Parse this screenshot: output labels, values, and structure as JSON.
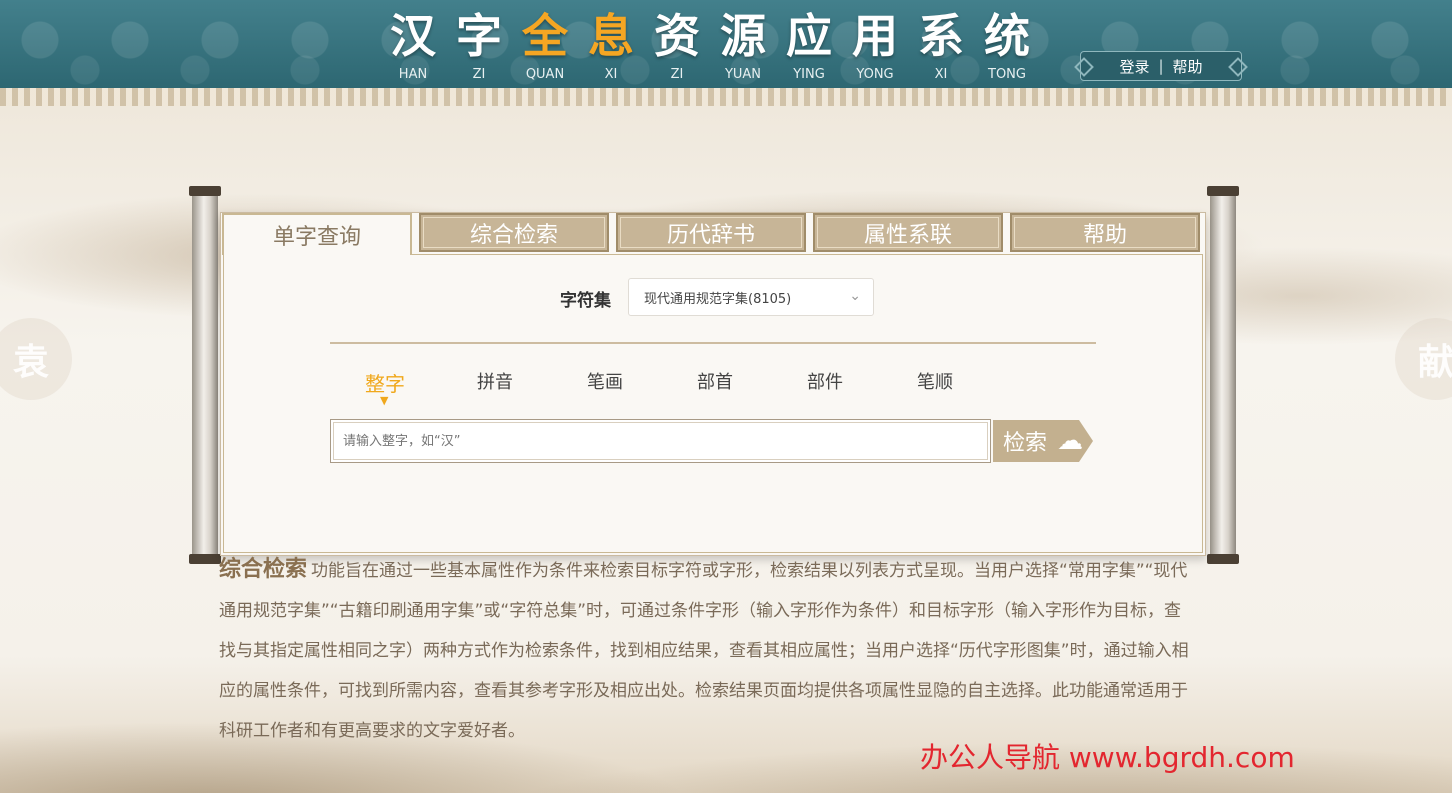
{
  "header": {
    "title_chars": [
      "汉",
      "字",
      "全",
      "息",
      "资",
      "源",
      "应",
      "用",
      "系",
      "统"
    ],
    "pinyin": [
      "HAN",
      "ZI",
      "QUAN",
      "XI",
      "ZI",
      "YUAN",
      "YING",
      "YONG",
      "XI",
      "TONG"
    ],
    "login": "登录",
    "separator": "|",
    "help": "帮助"
  },
  "side_seals": {
    "left": "袁",
    "right": "献"
  },
  "tabs": [
    "单字查询",
    "综合检索",
    "历代辞书",
    "属性系联",
    "帮助"
  ],
  "active_tab": "单字查询",
  "form": {
    "charset_label": "字符集",
    "charset_value": "现代通用规范字集(8105)",
    "modes": [
      "整字",
      "拼音",
      "笔画",
      "部首",
      "部件",
      "笔顺"
    ],
    "active_mode": "整字",
    "search_placeholder": "请输入整字，如“汉”",
    "search_button": "检索"
  },
  "description": {
    "term": "综合检索",
    "text": "功能旨在通过一些基本属性作为条件来检索目标字符或字形，检索结果以列表方式呈现。当用户选择“常用字集”“现代通用规范字集”“古籍印刷通用字集”或“字符总集”时，可通过条件字形（输入字形作为条件）和目标字形（输入字形作为目标，查找与其指定属性相同之字）两种方式作为检索条件，找到相应结果，查看其相应属性；当用户选择“历代字形图集”时，通过输入相应的属性条件，可找到所需内容，查看其参考字形及相应出处。检索结果页面均提供各项属性显隐的自主选择。此功能通常适用于科研工作者和有更高要求的文字爱好者。"
  },
  "watermark": "办公人导航  www.bgrdh.com"
}
